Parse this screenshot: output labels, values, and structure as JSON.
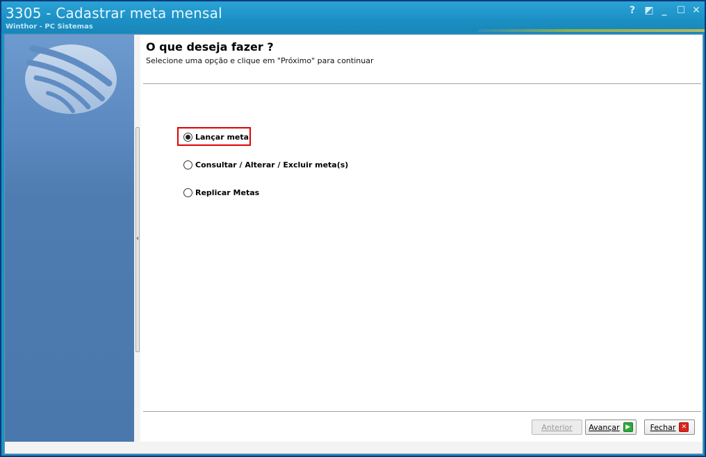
{
  "window": {
    "title": "3305 - Cadastrar meta mensal",
    "subtitle": "Winthor - PC Sistemas",
    "controls": {
      "help": "?",
      "restore_alt": "◩",
      "minimize": "_",
      "maximize": "☐",
      "close": "✕"
    }
  },
  "wizard": {
    "heading": "O que deseja fazer ?",
    "instruction": "Selecione uma opção e clique em \"Próximo\" para continuar",
    "options": [
      {
        "label": "Lançar meta",
        "selected": true
      },
      {
        "label": "Consultar / Alterar / Excluir meta(s)",
        "selected": false
      },
      {
        "label": "Replicar Metas",
        "selected": false
      }
    ]
  },
  "footer": {
    "back_label": "Anterior",
    "next_label": "Avançar",
    "close_label": "Fechar"
  },
  "splitter": {
    "arrow": "‹"
  },
  "colors": {
    "titlebar": "#1b8fc4",
    "sidebar": "#4e7cb0",
    "highlight": "#e00000"
  }
}
